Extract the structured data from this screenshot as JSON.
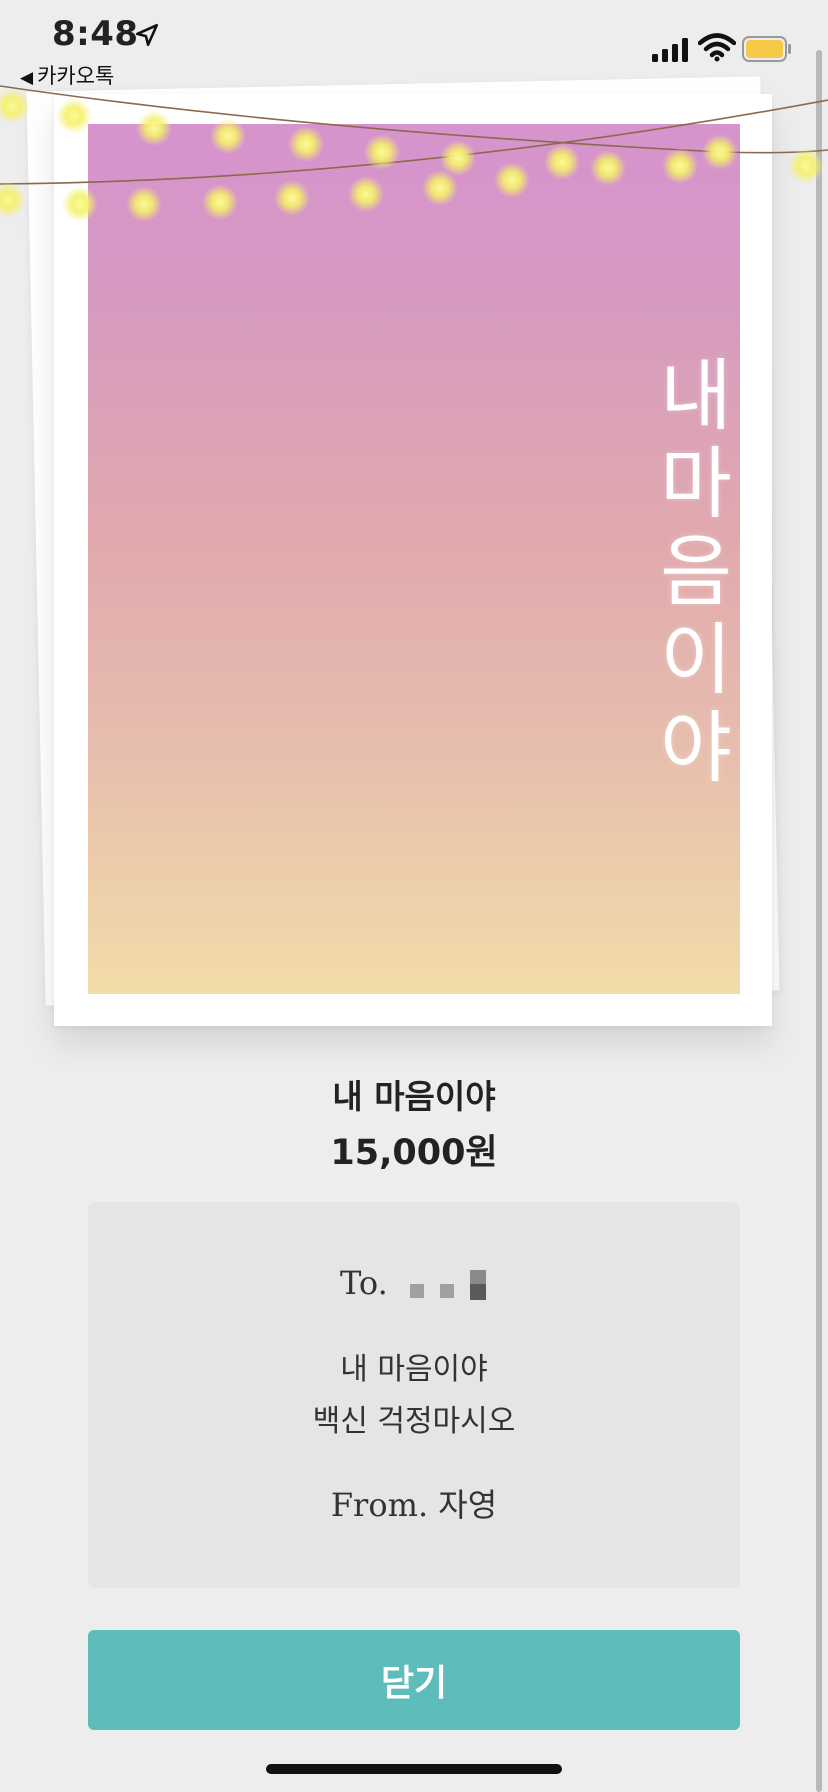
{
  "status_bar": {
    "time": "8:48",
    "back_app": "카카오톡"
  },
  "card": {
    "title_vertical": "내마음이야"
  },
  "product": {
    "name": "내 마음이야",
    "price": "15,000원"
  },
  "message": {
    "to_prefix": "To.",
    "body_line1": "내 마음이야",
    "body_line2": "백신 걱정마시오",
    "from": "From. 자영"
  },
  "actions": {
    "close_label": "닫기"
  },
  "colors": {
    "background": "#ededed",
    "accent": "#5ebdbb",
    "light_bulb": "#f4f06a",
    "battery": "#f7c948"
  },
  "icons": [
    "location-arrow-icon",
    "back-triangle-icon",
    "cellular-signal-icon",
    "wifi-icon",
    "battery-icon",
    "string-lights-decoration"
  ]
}
